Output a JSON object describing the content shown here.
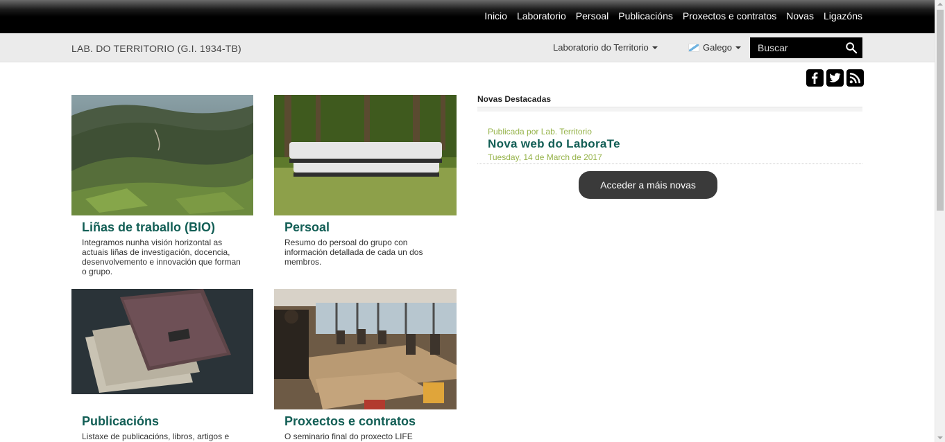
{
  "nav": {
    "items": [
      "Inicio",
      "Laboratorio",
      "Persoal",
      "Publicacións",
      "Proxectos e contratos",
      "Novas",
      "Ligazóns"
    ]
  },
  "subheader": {
    "site_name": "LAB. DO TERRITORIO (G.I. 1934-TB)",
    "lab_dropdown": "Laboratorio do Territorio",
    "language": "Galego",
    "search_placeholder": "Buscar"
  },
  "social": [
    "facebook-icon",
    "twitter-icon",
    "rss-icon"
  ],
  "cards": [
    {
      "title": "Liñas de traballo (BIO)",
      "desc": "Integramos nunha visión horizontal as actuais liñas de investigación, docencia, desenvolvemento e innovación que forman o grupo."
    },
    {
      "title": "Persoal",
      "desc": "Resumo do persoal do grupo con información detallada de cada un dos membros."
    },
    {
      "title": "Publicacións",
      "desc": "Listaxe de publicacións, libros, artigos e"
    },
    {
      "title": "Proxectos e contratos",
      "desc": "O seminario final do proxecto LIFE"
    }
  ],
  "news": {
    "heading": "Novas Destacadas",
    "author": "Publicada por Lab. Territorio",
    "title": "Nova web do LaboraTe",
    "date": "Tuesday, 14 de March de 2017",
    "more_button": "Acceder a máis novas"
  },
  "colors": {
    "title_green": "#125e55",
    "meta_green": "#96b34a",
    "button": "#3a3a3a"
  }
}
